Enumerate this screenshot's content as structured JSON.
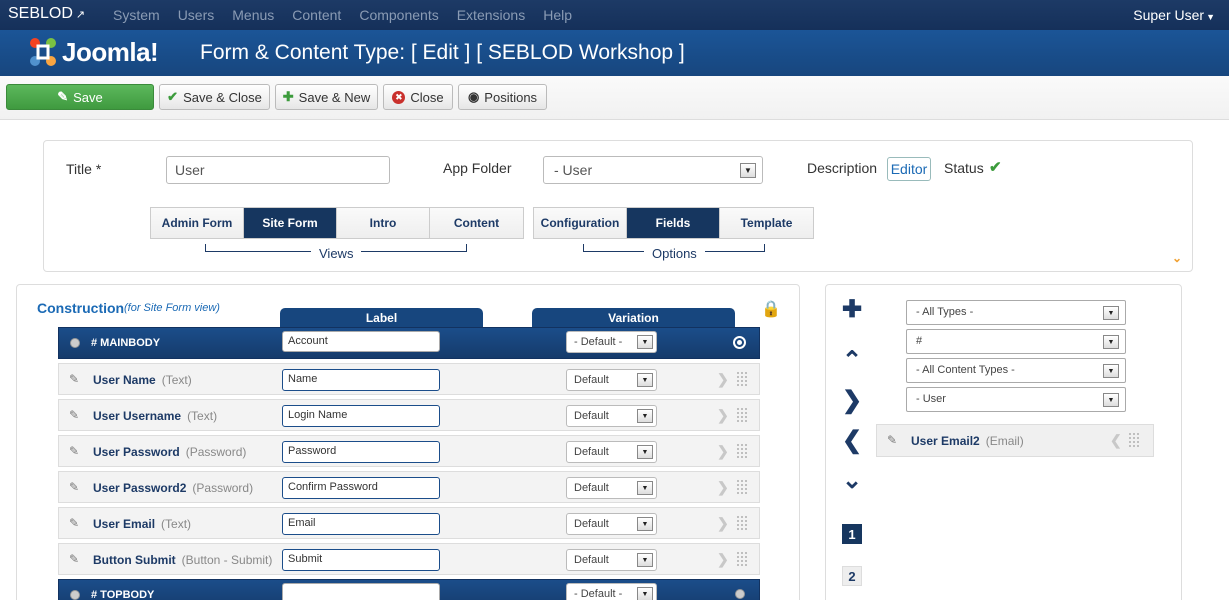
{
  "topnav": {
    "brand": "SEBLOD",
    "menu": [
      "System",
      "Users",
      "Menus",
      "Content",
      "Components",
      "Extensions",
      "Help"
    ],
    "user": "Super User"
  },
  "header": {
    "logo_text": "Joomla!",
    "title": "Form & Content Type: [ Edit ] [ SEBLOD Workshop ]"
  },
  "toolbar": {
    "save": "Save",
    "save_close": "Save & Close",
    "save_new": "Save & New",
    "close": "Close",
    "positions": "Positions"
  },
  "form": {
    "title_label": "Title",
    "title_required": "*",
    "title_value": "User",
    "app_folder_label": "App Folder",
    "app_folder_value": "- User",
    "description_label": "Description",
    "editor_button": "Editor",
    "status_label": "Status"
  },
  "views": {
    "tabs": [
      "Admin Form",
      "Site Form",
      "Intro",
      "Content"
    ],
    "active": "Site Form",
    "label": "Views"
  },
  "options": {
    "tabs": [
      "Configuration",
      "Fields",
      "Template"
    ],
    "active": "Fields",
    "label": "Options"
  },
  "construction": {
    "title": "Construction",
    "subtitle": "(for Site Form view)",
    "col_label": "Label",
    "col_variation": "Variation",
    "sections": [
      {
        "title": "# MAINBODY",
        "label": "Account",
        "variation": "- Default -"
      },
      {
        "title": "# TOPBODY",
        "label": "",
        "variation": "- Default -"
      }
    ],
    "fields": [
      {
        "name": "User Name",
        "type": "(Text)",
        "label": "Name",
        "variation": "Default"
      },
      {
        "name": "User Username",
        "type": "(Text)",
        "label": "Login Name",
        "variation": "Default"
      },
      {
        "name": "User Password",
        "type": "(Password)",
        "label": "Password",
        "variation": "Default"
      },
      {
        "name": "User Password2",
        "type": "(Password)",
        "label": "Confirm Password",
        "variation": "Default"
      },
      {
        "name": "User Email",
        "type": "(Text)",
        "label": "Email",
        "variation": "Default"
      },
      {
        "name": "Button Submit",
        "type": "(Button - Submit)",
        "label": "Submit",
        "variation": "Default"
      }
    ]
  },
  "filters": {
    "types": "- All Types -",
    "search": "#",
    "content_types": "- All Content Types -",
    "folder": "- User"
  },
  "available": {
    "name": "User Email2",
    "type": "(Email)"
  },
  "pagination": [
    "1",
    "2"
  ]
}
